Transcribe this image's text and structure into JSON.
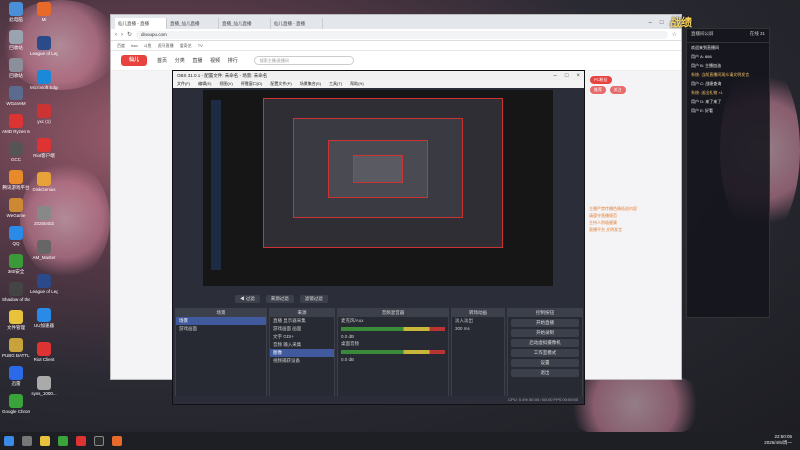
{
  "desktop": {
    "icons_left": [
      {
        "label": "此电脑",
        "color": "#4a90d9"
      },
      {
        "label": "回收站",
        "color": "#9aa4b0"
      },
      {
        "label": "回收站",
        "color": "#8a8f99"
      },
      {
        "label": "WGaVeM",
        "color": "#5a6b8f"
      },
      {
        "label": "AMD Ryzen Master",
        "color": "#d33"
      },
      {
        "label": "GCC",
        "color": "#555"
      },
      {
        "label": "腾讯游戏平台",
        "color": "#e88a2a"
      },
      {
        "label": "WeGame",
        "color": "#c83"
      },
      {
        "label": "QQ",
        "color": "#2a8ae8"
      },
      {
        "label": "360安全",
        "color": "#3a9a3a"
      },
      {
        "label": "Shadow of the Tomb",
        "color": "#444"
      },
      {
        "label": "文件管理",
        "color": "#e8c23a"
      },
      {
        "label": "PUBG BATTLEGR",
        "color": "#c8a23a"
      },
      {
        "label": "迅雷",
        "color": "#2a6ae8"
      },
      {
        "label": "Google Chrome",
        "color": "#3aa33a"
      }
    ],
    "icons_col2": [
      {
        "label": "Mi",
        "color": "#e86a2a"
      },
      {
        "label": "League of Legends",
        "color": "#2a4a8a"
      },
      {
        "label": "Microsoft Edge",
        "color": "#1a8ad8"
      },
      {
        "label": "yxc (1)",
        "color": "#c33"
      },
      {
        "label": "Riot客户端",
        "color": "#d33"
      },
      {
        "label": "DiskGenius",
        "color": "#e8a23a"
      },
      {
        "label": "20250402",
        "color": "#888"
      },
      {
        "label": "AM_Master",
        "color": "#666"
      },
      {
        "label": "League of Legends",
        "color": "#2a4a8a"
      },
      {
        "label": "UU加速器",
        "color": "#2a8ae8"
      },
      {
        "label": "Riot Client",
        "color": "#d33"
      },
      {
        "label": "syss_1000...",
        "color": "#aaa"
      }
    ]
  },
  "browser": {
    "tabs": [
      "仙儿直播 - 直播",
      "直播_仙儿直播",
      "直播_仙儿直播",
      "仙儿直播 - 直播"
    ],
    "url": "dinoupu.com",
    "bookmarks": [
      "百度",
      "hao",
      "斗鱼",
      "虎牙直播",
      "爱奇艺",
      "TV"
    ],
    "site": {
      "logo": "仙儿",
      "nav": [
        "首页",
        "分类",
        "直播",
        "视频",
        "排行"
      ],
      "search_placeholder": "搜索主播/直播间",
      "right_tags": [
        "PC粉丝",
        "推荐",
        "关注"
      ],
      "orange_lines": [
        "主播严禁传播色情低俗内容",
        "请遵守直播规范",
        "主持人积极健康",
        "直播平台 文明发言"
      ]
    }
  },
  "obs": {
    "title": "OBS 31.0.1 - 配置文件: 未命名 - 场景: 未命名",
    "menu": [
      "文件(F)",
      "编辑(E)",
      "视图(V)",
      "停靠窗口(D)",
      "配置文件(P)",
      "场景集合(S)",
      "工具(T)",
      "帮助(H)"
    ],
    "scene_buttons": [
      "◀ 过滤",
      "来源过滤",
      "滤镜过滤"
    ],
    "scenes": {
      "header": "场景",
      "items": [
        "场景",
        "游戏画面"
      ]
    },
    "sources": {
      "header": "来源",
      "items": [
        "直播 显示器采集",
        "游戏画面 画面",
        "文字 GDI+",
        "音频 输入采集",
        "图像",
        "视频捕获设备"
      ]
    },
    "mixer": {
      "header": "音频混音器",
      "channels": [
        {
          "name": "麦克风/Aux",
          "level": "0.0 dB"
        },
        {
          "name": "桌面音频",
          "level": "0.0 dB"
        }
      ]
    },
    "transitions": {
      "header": "转场动画",
      "type": "淡入淡出",
      "duration": "300 ms"
    },
    "controls": {
      "header": "控制按钮",
      "buttons": [
        "开始直播",
        "开始录制",
        "启动虚拟摄像机",
        "工作室模式",
        "设置",
        "退出"
      ]
    },
    "status": "CPU: 0.4%  60.00 / 60.00 FPS  00:00:00"
  },
  "chat": {
    "header": "直播间公屏",
    "viewer_count": "在线 31",
    "messages": [
      {
        "text": "欢迎来到直播间",
        "hl": false
      },
      {
        "text": "用户 A: 666",
        "hl": false
      },
      {
        "text": "用户 B: 主播加油",
        "hl": false
      },
      {
        "text": "系统: 当前直播间观众请文明发言",
        "hl": true
      },
      {
        "text": "用户 C: 战绩查询",
        "hl": false
      },
      {
        "text": "系统: 送出礼物 ×1",
        "hl": true
      },
      {
        "text": "用户 D: 来了来了",
        "hl": false
      },
      {
        "text": "用户 E: 好看",
        "hl": false
      }
    ],
    "badge": "战绩"
  },
  "taskbar": {
    "time": "22:50:05",
    "date": "2025/4/6/周一"
  }
}
